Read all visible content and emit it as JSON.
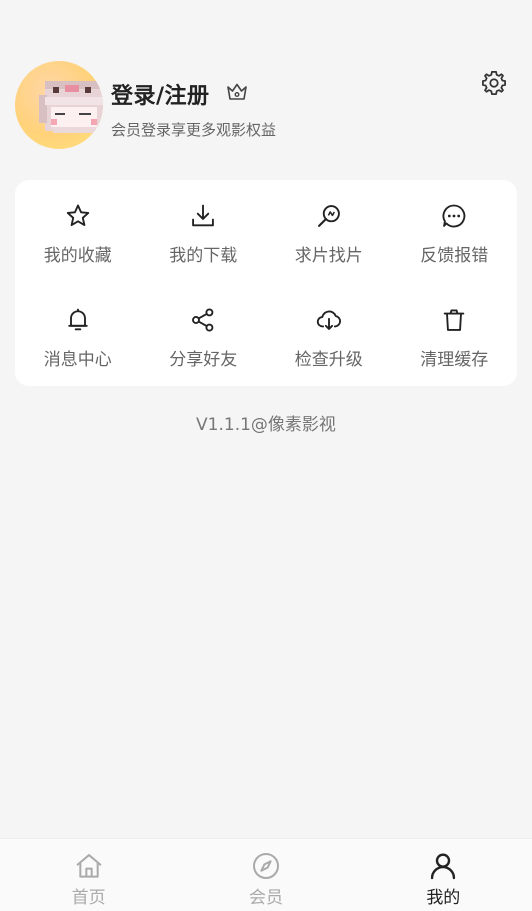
{
  "profile": {
    "title": "登录/注册",
    "subtitle": "会员登录享更多观影权益"
  },
  "menu": [
    {
      "label": "我的收藏",
      "icon": "star-icon"
    },
    {
      "label": "我的下载",
      "icon": "download-icon"
    },
    {
      "label": "求片找片",
      "icon": "search-film-icon"
    },
    {
      "label": "反馈报错",
      "icon": "feedback-icon"
    },
    {
      "label": "消息中心",
      "icon": "bell-icon"
    },
    {
      "label": "分享好友",
      "icon": "share-icon"
    },
    {
      "label": "检查升级",
      "icon": "cloud-download-icon"
    },
    {
      "label": "清理缓存",
      "icon": "trash-icon"
    }
  ],
  "version": "V1.1.1@像素影视",
  "tabs": [
    {
      "label": "首页",
      "icon": "home-icon",
      "active": false
    },
    {
      "label": "会员",
      "icon": "compass-icon",
      "active": false
    },
    {
      "label": "我的",
      "icon": "user-icon",
      "active": true
    }
  ],
  "colors": {
    "background": "#f5f5f5",
    "card": "#ffffff",
    "text_primary": "#222222",
    "text_secondary": "#666666",
    "tab_inactive": "#aaaaaa",
    "avatar_bg": "#ffd27a"
  }
}
